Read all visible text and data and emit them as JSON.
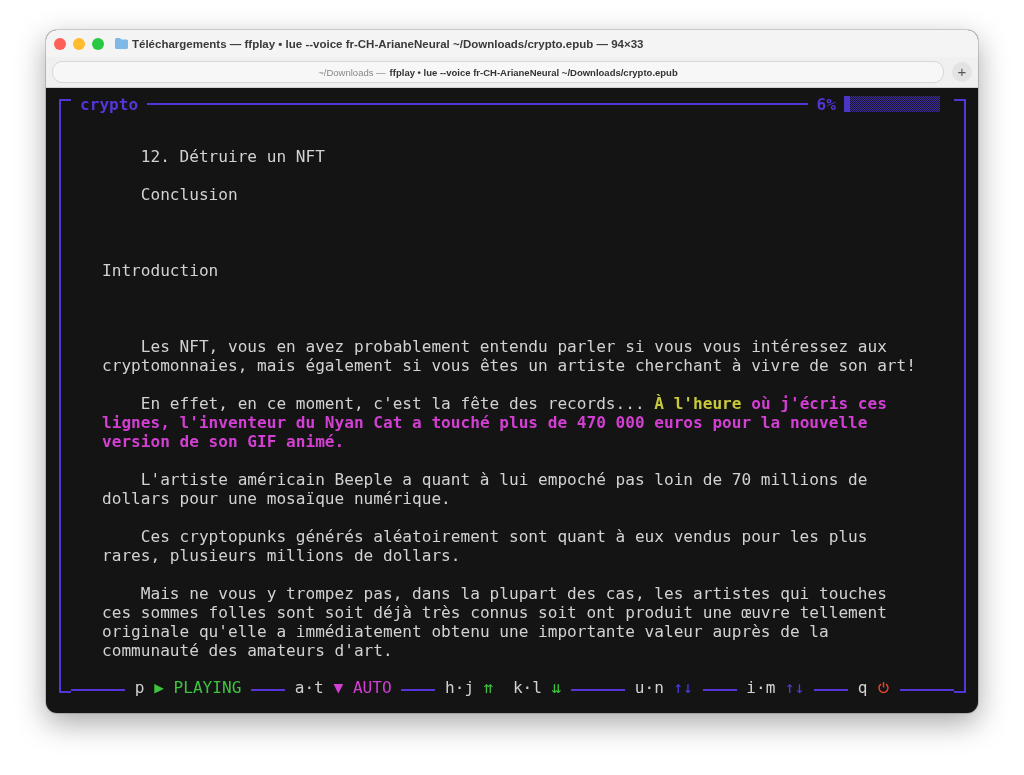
{
  "window": {
    "title": "Téléchargements — ffplay • lue --voice fr-CH-ArianeNeural ~/Downloads/crypto.epub — 94×33",
    "tab": {
      "path": "~/Downloads —",
      "command": "ffplay • lue --voice fr-CH-ArianeNeural ~/Downloads/crypto.epub"
    },
    "new_tab": "+"
  },
  "reader": {
    "title": "crypto",
    "percent": "6%",
    "progress": {
      "level": 0.06
    },
    "blocks": [
      {
        "kind": "toc",
        "text": "12. Détruire un NFT"
      },
      {
        "kind": "toc",
        "text": "Conclusion"
      },
      {
        "kind": "heading",
        "text": "Introduction"
      },
      {
        "kind": "paragraph",
        "segments": [
          {
            "kind": "plain",
            "text": "Les NFT, vous en avez probablement entendu parler si vous vous intéressez aux cryptomonnaies, mais également si vous êtes un artiste cherchant à vivre de son art!"
          }
        ]
      },
      {
        "kind": "paragraph",
        "segments": [
          {
            "kind": "plain",
            "text": "En effet, en ce moment, c'est la fête des records... "
          },
          {
            "kind": "current",
            "text": "À l'heure"
          },
          {
            "kind": "spoken",
            "text": " où j'écris ces lignes, l'inventeur du Nyan Cat a touché plus de 470 000 euros pour la nouvelle version de son GIF animé."
          }
        ]
      },
      {
        "kind": "paragraph",
        "segments": [
          {
            "kind": "plain",
            "text": "L'artiste américain Beeple a quant à lui empoché pas loin de 70 millions de dollars pour une mosaïque numérique."
          }
        ]
      },
      {
        "kind": "paragraph",
        "segments": [
          {
            "kind": "plain",
            "text": "Ces cryptopunks générés aléatoirement sont quant à eux vendus pour les plus rares, plusieurs millions de dollars."
          }
        ]
      },
      {
        "kind": "paragraph",
        "segments": [
          {
            "kind": "plain",
            "text": "Mais ne vous y trompez pas, dans la plupart des cas, les artistes qui touches ces sommes folles sont soit déjà très connus soit ont produit une œuvre tellement originale qu'elle a immédiatement obtenu une importante valeur auprès de la communauté des amateurs d'art."
          }
        ]
      }
    ]
  },
  "controls": [
    {
      "keys": "p",
      "glyph": "▶",
      "label": "PLAYING",
      "color": "#3fc23f"
    },
    {
      "keys": "a·t",
      "glyph": "▼",
      "label": "AUTO",
      "color": "#d23fd2"
    },
    {
      "keys": "h·j",
      "glyph": "⇈",
      "color": "#3fc23f"
    },
    {
      "keys": "k·l",
      "glyph": "⇊",
      "color": "#3fc23f"
    },
    {
      "keys": "u·n",
      "glyph": "↑↓",
      "color": "#4a3fe0"
    },
    {
      "keys": "i·m",
      "glyph": "↑↓",
      "color": "#4a3fe0"
    },
    {
      "keys": "q",
      "power": true,
      "color": "#e0452f"
    }
  ]
}
